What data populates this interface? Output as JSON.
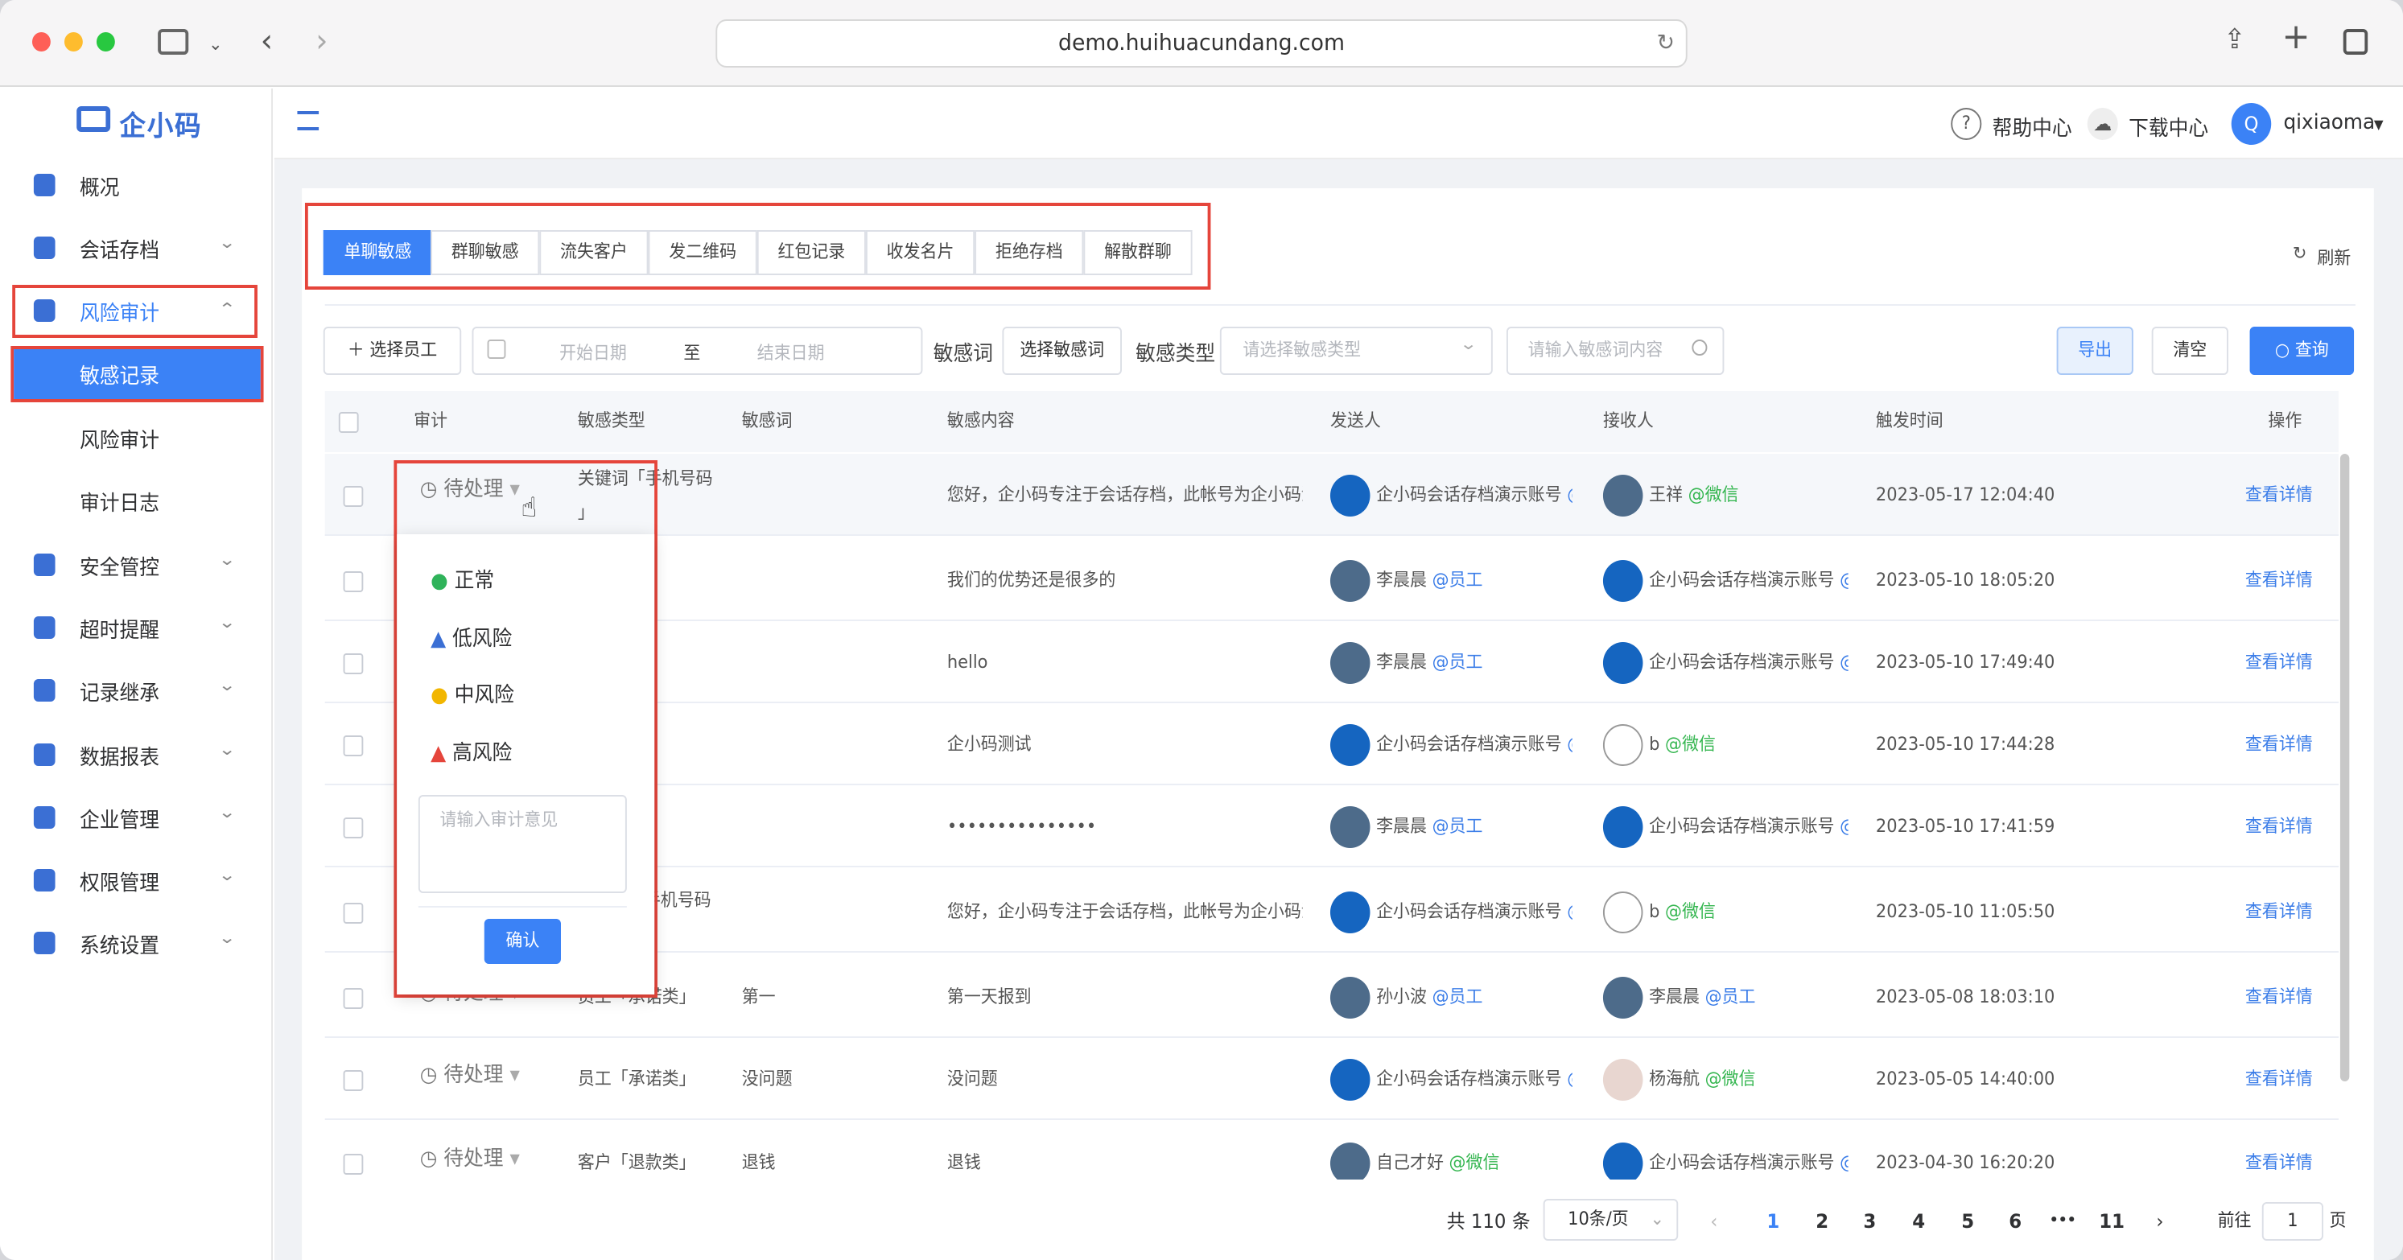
{
  "browser": {
    "url": "demo.huihuacundang.com"
  },
  "logo": "企小码",
  "sidebar": {
    "items": [
      {
        "label": "概况",
        "icon": "home-icon"
      },
      {
        "label": "会话存档",
        "icon": "folder-icon"
      },
      {
        "label": "风险审计",
        "icon": "edit-icon"
      },
      {
        "label": "敏感记录"
      },
      {
        "label": "风险审计"
      },
      {
        "label": "审计日志"
      },
      {
        "label": "安全管控",
        "icon": "shield-icon"
      },
      {
        "label": "超时提醒",
        "icon": "bell-icon"
      },
      {
        "label": "记录继承",
        "icon": "transfer-icon"
      },
      {
        "label": "数据报表",
        "icon": "bar-chart-icon"
      },
      {
        "label": "企业管理",
        "icon": "refresh-icon"
      },
      {
        "label": "权限管理",
        "icon": "lock-shield-icon"
      },
      {
        "label": "系统设置",
        "icon": "gear-icon"
      }
    ]
  },
  "topbar": {
    "help": "帮助中心",
    "download": "下载中心",
    "avatar_letter": "Q",
    "user": "qixiaoma"
  },
  "tabs": [
    "单聊敏感",
    "群聊敏感",
    "流失客户",
    "发二维码",
    "红包记录",
    "收发名片",
    "拒绝存档",
    "解散群聊"
  ],
  "refresh": "刷新",
  "filters": {
    "select_staff": "选择员工",
    "start_date": "开始日期",
    "to": "至",
    "end_date": "结束日期",
    "word_label": "敏感词",
    "word_btn": "选择敏感词",
    "type_label": "敏感类型",
    "type_placeholder": "请选择敏感类型",
    "content_placeholder": "请输入敏感词内容",
    "export": "导出",
    "clear": "清空",
    "query": "查询"
  },
  "table": {
    "headers": [
      "审计",
      "敏感类型",
      "敏感词",
      "敏感内容",
      "发送人",
      "接收人",
      "触发时间",
      "操作"
    ],
    "rows": [
      {
        "audit": "待处理",
        "type": "关键词「手机号码",
        "type2": "」",
        "word": "",
        "content": "您好，企小码专注于会话存档，此帐号为企小码演",
        "sender": "企小码会话存档演示账号",
        "sender_tag": "@",
        "receiver": "王祥",
        "receiver_tag": "@微信",
        "time": "2023-05-17 12:04:40",
        "action": "查看详情"
      },
      {
        "audit": "",
        "type": "",
        "word": "",
        "content": "我们的优势还是很多的",
        "sender": "李晨晨",
        "sender_tag": "@员工",
        "receiver": "企小码会话存档演示账号",
        "receiver_tag": "@",
        "time": "2023-05-10 18:05:20",
        "action": "查看详情"
      },
      {
        "audit": "",
        "type": "",
        "word": "",
        "content": "hello",
        "sender": "李晨晨",
        "sender_tag": "@员工",
        "receiver": "企小码会话存档演示账号",
        "receiver_tag": "@",
        "time": "2023-05-10 17:49:40",
        "action": "查看详情"
      },
      {
        "audit": "",
        "type": "",
        "word": "",
        "content": "企小码测试",
        "sender": "企小码会话存档演示账号",
        "sender_tag": "@",
        "receiver": "b",
        "receiver_tag": "@微信",
        "time": "2023-05-10 17:44:28",
        "action": "查看详情"
      },
      {
        "audit": "",
        "type": "",
        "word": "",
        "content": "•••••••••••••••",
        "sender": "李晨晨",
        "sender_tag": "@员工",
        "receiver": "企小码会话存档演示账号",
        "receiver_tag": "@",
        "time": "2023-05-10 17:41:59",
        "action": "查看详情"
      },
      {
        "audit": "",
        "type": "手机号码",
        "word": "",
        "content": "您好，企小码专注于会话存档，此帐号为企小码演",
        "sender": "企小码会话存档演示账号",
        "sender_tag": "@",
        "receiver": "b",
        "receiver_tag": "@微信",
        "time": "2023-05-10 11:05:50",
        "action": "查看详情"
      },
      {
        "audit": "待处理",
        "type": "员工「承诺类」",
        "word": "第一",
        "content": "第一天报到",
        "sender": "孙小波",
        "sender_tag": "@员工",
        "receiver": "李晨晨",
        "receiver_tag": "@员工",
        "time": "2023-05-08 18:03:10",
        "action": "查看详情"
      },
      {
        "audit": "待处理",
        "type": "员工「承诺类」",
        "word": "没问题",
        "content": "没问题",
        "sender": "企小码会话存档演示账号",
        "sender_tag": "@",
        "receiver": "杨海航",
        "receiver_tag": "@微信",
        "time": "2023-05-05 14:40:00",
        "action": "查看详情"
      },
      {
        "audit": "待处理",
        "type": "客户「退款类」",
        "word": "退钱",
        "content": "退钱",
        "sender": "自己才好",
        "sender_tag": "@微信",
        "receiver": "企小码会话存档演示账号",
        "receiver_tag": "@",
        "time": "2023-04-30 16:20:20",
        "action": "查看详情"
      }
    ]
  },
  "popup": {
    "options": [
      {
        "label": "正常",
        "color": "#2fb35a"
      },
      {
        "label": "低风险",
        "color": "#3b6fd4"
      },
      {
        "label": "中风险",
        "color": "#f2b600"
      },
      {
        "label": "高风险",
        "color": "#e5453b"
      }
    ],
    "placeholder": "请输入审计意见",
    "confirm": "确认"
  },
  "pagination": {
    "total": "共 110 条",
    "page_size": "10条/页",
    "pages": [
      "1",
      "2",
      "3",
      "4",
      "5",
      "6",
      "•••",
      "11"
    ],
    "goto": "前往",
    "goto_value": "1",
    "page_unit": "页"
  }
}
